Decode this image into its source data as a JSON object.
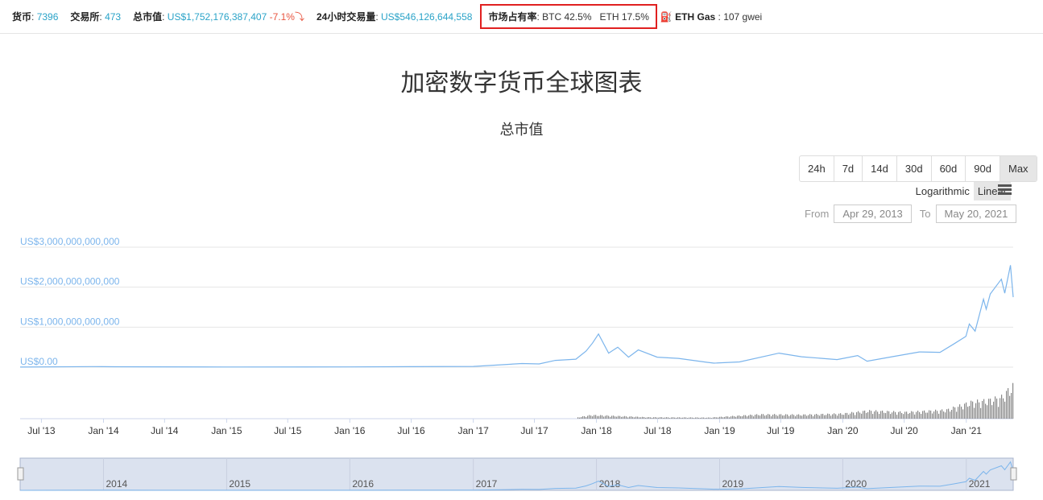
{
  "topbar": {
    "coins_label": "货币",
    "coins": "7396",
    "exchanges_label": "交易所",
    "exchanges": "473",
    "mcap_label": "总市值",
    "mcap": "US$1,752,176,387,407",
    "mcap_change": "-7.1%",
    "vol_label": "24小时交易量",
    "vol": "US$546,126,644,558",
    "dominance_label": "市场占有率",
    "btc": "BTC 42.5%",
    "eth": "ETH 17.5%",
    "gas_label": "ETH Gas",
    "gas": "107 gwei"
  },
  "page_title": "加密数字货币全球图表",
  "chart_title": "总市值",
  "ranges": [
    "24h",
    "7d",
    "14d",
    "30d",
    "60d",
    "90d",
    "Max"
  ],
  "active_range": "Max",
  "scale": {
    "log": "Logarithmic",
    "linear": "Linear",
    "active": "Linear"
  },
  "dates": {
    "from_label": "From",
    "from": "Apr 29, 2013",
    "to_label": "To",
    "to": "May 20, 2021"
  },
  "chart_data": {
    "type": "line",
    "y_ticks": [
      "US$0.00",
      "US$1,000,000,000,000",
      "US$2,000,000,000,000",
      "US$3,000,000,000,000"
    ],
    "ylim": [
      0,
      3000000000000
    ],
    "x_ticks": [
      "Jul '13",
      "Jan '14",
      "Jul '14",
      "Jan '15",
      "Jul '15",
      "Jan '16",
      "Jul '16",
      "Jan '17",
      "Jul '17",
      "Jan '18",
      "Jul '18",
      "Jan '19",
      "Jul '19",
      "Jan '20",
      "Jul '20",
      "Jan '21"
    ],
    "navigator_labels": [
      "2014",
      "2015",
      "2016",
      "2017",
      "2018",
      "2019",
      "2020",
      "2021"
    ],
    "line_color": "#7cb5ec",
    "volume_color": "#888888",
    "market_cap_billions": [
      [
        "2013-04-29",
        1.5
      ],
      [
        "2013-11-30",
        14
      ],
      [
        "2014-02-01",
        11
      ],
      [
        "2014-06-01",
        8
      ],
      [
        "2015-01-01",
        4
      ],
      [
        "2016-01-01",
        7
      ],
      [
        "2016-07-01",
        12
      ],
      [
        "2017-01-01",
        18
      ],
      [
        "2017-05-25",
        90
      ],
      [
        "2017-07-15",
        80
      ],
      [
        "2017-09-01",
        170
      ],
      [
        "2017-11-01",
        200
      ],
      [
        "2017-12-01",
        400
      ],
      [
        "2017-12-20",
        600
      ],
      [
        "2018-01-07",
        830
      ],
      [
        "2018-02-06",
        350
      ],
      [
        "2018-03-05",
        500
      ],
      [
        "2018-04-06",
        250
      ],
      [
        "2018-05-05",
        430
      ],
      [
        "2018-06-30",
        250
      ],
      [
        "2018-09-01",
        220
      ],
      [
        "2018-11-25",
        120
      ],
      [
        "2018-12-15",
        100
      ],
      [
        "2019-03-01",
        130
      ],
      [
        "2019-06-26",
        350
      ],
      [
        "2019-09-01",
        260
      ],
      [
        "2019-12-15",
        190
      ],
      [
        "2020-02-14",
        290
      ],
      [
        "2020-03-13",
        150
      ],
      [
        "2020-06-01",
        270
      ],
      [
        "2020-08-15",
        380
      ],
      [
        "2020-10-15",
        370
      ],
      [
        "2020-11-25",
        580
      ],
      [
        "2020-12-31",
        770
      ],
      [
        "2021-01-10",
        1080
      ],
      [
        "2021-01-27",
        900
      ],
      [
        "2021-02-21",
        1700
      ],
      [
        "2021-03-01",
        1450
      ],
      [
        "2021-03-13",
        1830
      ],
      [
        "2021-04-15",
        2200
      ],
      [
        "2021-04-25",
        1850
      ],
      [
        "2021-05-12",
        2550
      ],
      [
        "2021-05-20",
        1750
      ]
    ],
    "volume_billions": [
      [
        "2017-11-01",
        15
      ],
      [
        "2017-12-15",
        50
      ],
      [
        "2018-01-15",
        45
      ],
      [
        "2018-06-01",
        20
      ],
      [
        "2018-12-01",
        15
      ],
      [
        "2019-05-01",
        60
      ],
      [
        "2019-09-01",
        55
      ],
      [
        "2020-01-01",
        70
      ],
      [
        "2020-03-15",
        110
      ],
      [
        "2020-07-01",
        90
      ],
      [
        "2020-11-01",
        120
      ],
      [
        "2021-01-15",
        230
      ],
      [
        "2021-03-01",
        250
      ],
      [
        "2021-04-15",
        300
      ],
      [
        "2021-05-15",
        450
      ]
    ]
  }
}
